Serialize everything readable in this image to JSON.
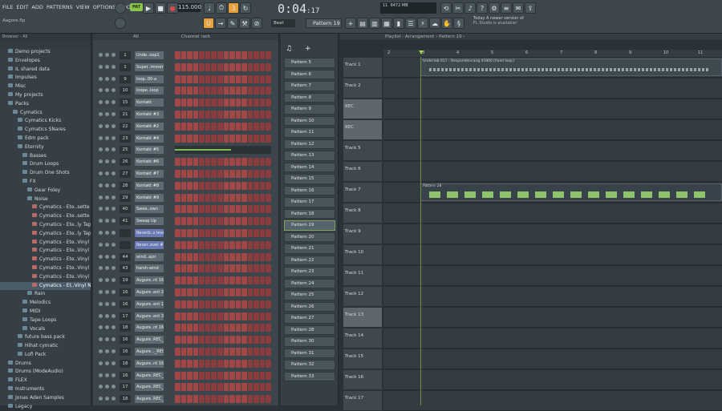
{
  "menu": [
    "FILE",
    "EDIT",
    "ADD",
    "PATTERNS",
    "VIEW",
    "OPTIONS",
    "TOOLS",
    "HELP"
  ],
  "hint": "Aagore.flp",
  "transport": {
    "pat_song": "PAT",
    "tempo": "115.000",
    "time_main": "0:04",
    "time_sub": ":17",
    "pattern_selector": "Pattern 19",
    "snap": "Beat"
  },
  "memory": {
    "cpu": "6472 MB",
    "poly": "11"
  },
  "news": {
    "line1": "Today  A newer version of",
    "line2": "FL Studio is available!"
  },
  "browser": {
    "title": "Browser - All",
    "items": [
      {
        "label": "Demo projects",
        "indent": 1,
        "type": "folder"
      },
      {
        "label": "Envelopes",
        "indent": 1,
        "type": "folder"
      },
      {
        "label": "IL shared data",
        "indent": 1,
        "type": "folder"
      },
      {
        "label": "Impulses",
        "indent": 1,
        "type": "folder"
      },
      {
        "label": "Misc",
        "indent": 1,
        "type": "folder"
      },
      {
        "label": "My projects",
        "indent": 1,
        "type": "folder"
      },
      {
        "label": "Packs",
        "indent": 1,
        "type": "folder"
      },
      {
        "label": "Cymatics",
        "indent": 2,
        "type": "folder"
      },
      {
        "label": "Cymatics Kicks",
        "indent": 3,
        "type": "folder"
      },
      {
        "label": "Cymatics SNares",
        "indent": 3,
        "type": "folder"
      },
      {
        "label": "Edm pack",
        "indent": 3,
        "type": "folder"
      },
      {
        "label": "Eternity",
        "indent": 3,
        "type": "folder"
      },
      {
        "label": "Basses",
        "indent": 4,
        "type": "folder"
      },
      {
        "label": "Drum Loops",
        "indent": 4,
        "type": "folder"
      },
      {
        "label": "Drum One Shots",
        "indent": 4,
        "type": "folder"
      },
      {
        "label": "FX",
        "indent": 4,
        "type": "folder"
      },
      {
        "label": "Gear Foley",
        "indent": 5,
        "type": "folder"
      },
      {
        "label": "Noise",
        "indent": 5,
        "type": "folder"
      },
      {
        "label": "Cymatics - Ete..sette Noise 1",
        "indent": 6,
        "type": "file"
      },
      {
        "label": "Cymatics - Ete..sette Noise 2",
        "indent": 6,
        "type": "file"
      },
      {
        "label": "Cymatics - Ete..ly Tape Hiss 1",
        "indent": 6,
        "type": "file"
      },
      {
        "label": "Cymatics - Ete..ly Tape Hiss 2",
        "indent": 6,
        "type": "file"
      },
      {
        "label": "Cymatics - Ete..Vinyl Noise 1",
        "indent": 6,
        "type": "file"
      },
      {
        "label": "Cymatics - Ete..Vinyl Noise 2",
        "indent": 6,
        "type": "file"
      },
      {
        "label": "Cymatics - Ete..Vinyl Noise 3",
        "indent": 6,
        "type": "file"
      },
      {
        "label": "Cymatics - Ete..Vinyl Noise 4",
        "indent": 6,
        "type": "file"
      },
      {
        "label": "Cymatics - Ete..Vinyl Noise 5",
        "indent": 6,
        "type": "file"
      },
      {
        "label": "Cymatics - Et..Vinyl Noise 6",
        "indent": 6,
        "type": "file",
        "selected": true
      },
      {
        "label": "Rain",
        "indent": 5,
        "type": "folder"
      },
      {
        "label": "Melodics",
        "indent": 4,
        "type": "folder"
      },
      {
        "label": "MIDI",
        "indent": 4,
        "type": "folder"
      },
      {
        "label": "Tape Loops",
        "indent": 4,
        "type": "folder"
      },
      {
        "label": "Vocals",
        "indent": 4,
        "type": "folder"
      },
      {
        "label": "future bass pack",
        "indent": 3,
        "type": "folder"
      },
      {
        "label": "Hihat cymatic",
        "indent": 3,
        "type": "folder"
      },
      {
        "label": "Lofi Pack",
        "indent": 3,
        "type": "folder"
      },
      {
        "label": "Drums",
        "indent": 1,
        "type": "folder"
      },
      {
        "label": "Drums (ModeAudio)",
        "indent": 1,
        "type": "folder"
      },
      {
        "label": "FLEX",
        "indent": 1,
        "type": "folder"
      },
      {
        "label": "Instruments",
        "indent": 1,
        "type": "folder"
      },
      {
        "label": "Jonas Aden Samples",
        "indent": 1,
        "type": "folder"
      },
      {
        "label": "Legacy",
        "indent": 1,
        "type": "folder"
      }
    ]
  },
  "channel_rack": {
    "title": "Channel rack",
    "filter": "All",
    "rows": [
      {
        "num": "1",
        "name": "Unde..oop1",
        "blue": false
      },
      {
        "num": "1",
        "name": "Super..immer 3",
        "blue": false
      },
      {
        "num": "9",
        "name": "loop..00-a",
        "blue": false
      },
      {
        "num": "10",
        "name": "loope..loop",
        "blue": false
      },
      {
        "num": "15",
        "name": "Kontakt",
        "blue": false
      },
      {
        "num": "21",
        "name": "Kontakt #3",
        "blue": false
      },
      {
        "num": "22",
        "name": "Kontakt #2",
        "blue": false
      },
      {
        "num": "23",
        "name": "Kontakt #4",
        "blue": false
      },
      {
        "num": "25",
        "name": "Kontakt #5",
        "blue": false
      },
      {
        "num": "26",
        "name": "Kontakt #6",
        "blue": false
      },
      {
        "num": "27",
        "name": "Kontakt #7",
        "blue": false
      },
      {
        "num": "28",
        "name": "Kontakt #8",
        "blue": false
      },
      {
        "num": "29",
        "name": "Kontakt #9",
        "blue": false
      },
      {
        "num": "40",
        "name": "Swee..own",
        "blue": false
      },
      {
        "num": "41",
        "name": "Sweep Up",
        "blue": false
      },
      {
        "num": "",
        "name": "Reverb..s level",
        "blue": true
      },
      {
        "num": "",
        "name": "Rever..evel #2",
        "blue": true
      },
      {
        "num": "44",
        "name": "wind..ajor",
        "blue": false
      },
      {
        "num": "43",
        "name": "harsh-wind",
        "blue": false
      },
      {
        "num": "19",
        "name": "Augure..nt 16_4",
        "blue": false
      },
      {
        "num": "16",
        "name": "Augure..ent 28",
        "blue": false
      },
      {
        "num": "16",
        "name": "Augure..ent 17",
        "blue": false
      },
      {
        "num": "17",
        "name": "Augure..ent 38",
        "blue": false
      },
      {
        "num": "18",
        "name": "Augure..nt 16_3",
        "blue": false
      },
      {
        "num": "16",
        "name": "Augure..REC_5",
        "blue": false
      },
      {
        "num": "16",
        "name": "Augure..._REC",
        "blue": false
      },
      {
        "num": "18",
        "name": "Augure..nt 16_5",
        "blue": false
      },
      {
        "num": "16",
        "name": "Augure..REC_4",
        "blue": false
      },
      {
        "num": "17",
        "name": "Augure..REC_6",
        "blue": false
      },
      {
        "num": "18",
        "name": "Augure..REC_3",
        "blue": false
      }
    ]
  },
  "patterns": [
    "Pattern 5",
    "Pattern 6",
    "Pattern 7",
    "Pattern 8",
    "Pattern 9",
    "Pattern 10",
    "Pattern 11",
    "Pattern 12",
    "Pattern 13",
    "Pattern 14",
    "Pattern 15",
    "Pattern 16",
    "Pattern 17",
    "Pattern 18",
    "Pattern 19",
    "Pattern 20",
    "Pattern 21",
    "Pattern 22",
    "Pattern 23",
    "Pattern 24",
    "Pattern 25",
    "Pattern 26",
    "Pattern 27",
    "Pattern 28",
    "Pattern 30",
    "Pattern 31",
    "Pattern 32",
    "Pattern 33"
  ],
  "selected_pattern": "Pattern 19",
  "playlist": {
    "title": "Playlist - Arrangement › Pattern 19 ›",
    "ruler": [
      "2",
      "3",
      "4",
      "5",
      "6",
      "7",
      "8",
      "9",
      "10",
      "11"
    ],
    "tracks": [
      {
        "label": "Track 1",
        "hl": false
      },
      {
        "label": "Track 2",
        "hl": false
      },
      {
        "label": "REC",
        "hl": true
      },
      {
        "label": "REC",
        "hl": true
      },
      {
        "label": "Track 5",
        "hl": false
      },
      {
        "label": "Track 6",
        "hl": false
      },
      {
        "label": "Track 7",
        "hl": false
      },
      {
        "label": "Track 8",
        "hl": false
      },
      {
        "label": "Track 9",
        "hl": false
      },
      {
        "label": "Track 10",
        "hl": false
      },
      {
        "label": "Track 11",
        "hl": false
      },
      {
        "label": "Track 12",
        "hl": false
      },
      {
        "label": "Track 13",
        "hl": true
      },
      {
        "label": "Track 14",
        "hl": false
      },
      {
        "label": "Track 15",
        "hl": false
      },
      {
        "label": "Track 16",
        "hl": false
      },
      {
        "label": "Track 17",
        "hl": false
      }
    ],
    "audio_clip": "Underlab 017 - Bespondencang 45800 [fixed loop]",
    "pattern_clip": "Pattern 28"
  }
}
